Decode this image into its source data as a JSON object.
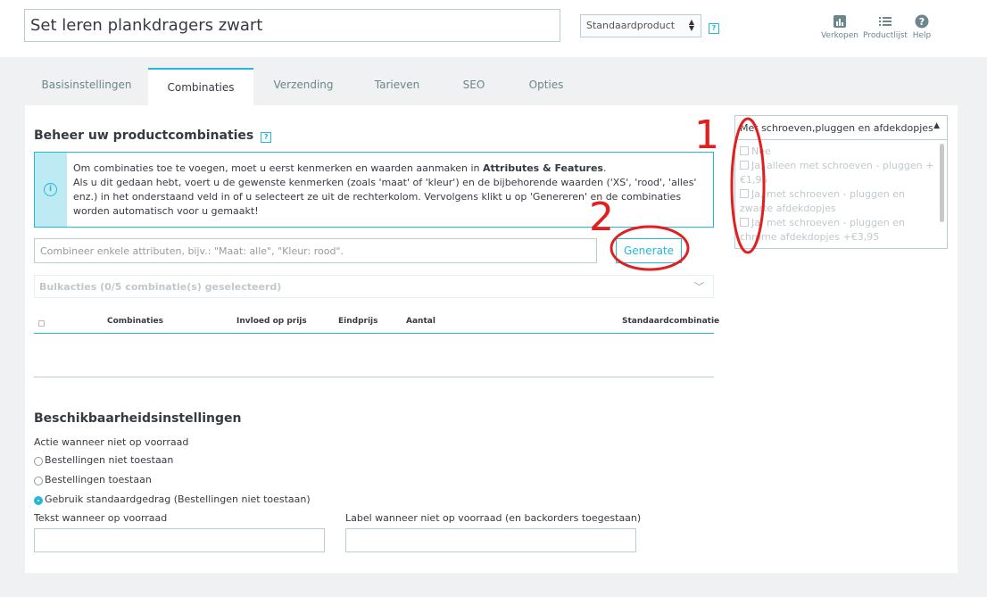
{
  "header": {
    "product_name": "Set leren plankdragers zwart",
    "product_type": "Standaardproduct",
    "help_mark": "?",
    "nav": [
      {
        "label": "Verkopen",
        "icon": "chart-bar-icon"
      },
      {
        "label": "Productlijst",
        "icon": "list-icon"
      },
      {
        "label": "Help",
        "icon": "help-circle-icon"
      }
    ]
  },
  "tabs": [
    "Basisinstellingen",
    "Combinaties",
    "Verzending",
    "Tarieven",
    "SEO",
    "Opties"
  ],
  "active_tab": "Combinaties",
  "combinations": {
    "title": "Beheer uw productcombinaties",
    "help_mark": "?",
    "info_text_1": "Om combinaties toe te voegen, moet u eerst kenmerken en waarden aanmaken in ",
    "info_link": "Attributes & Features",
    "info_text_2": ".",
    "info_text_3": "Als u dit gedaan hebt, voert u de gewenste kenmerken (zoals 'maat' of 'kleur') en de bijbehorende waarden ('XS', 'rood', 'alles' enz.) in het onderstaand veld in of u selecteert ze uit de rechterkolom. Vervolgens klikt u op 'Genereren' en de combinaties worden automatisch voor u gemaakt!",
    "input_placeholder": "Combineer enkele attributen, bijv.: \"Maat: alle\", \"Kleur: rood\".",
    "generate_label": "Generate",
    "bulk_label": "Bulkacties (0/5 combinatie(s) geselecteerd)",
    "columns": [
      "Combinaties",
      "Invloed op prijs",
      "Eindprijs",
      "Aantal",
      "Standaardcombinatie"
    ]
  },
  "availability": {
    "title": "Beschikbaarheidsinstellingen",
    "oos_action_label": "Actie wanneer niet op voorraad",
    "options": [
      {
        "label": "Bestellingen niet toestaan",
        "selected": false
      },
      {
        "label": "Bestellingen toestaan",
        "selected": false
      },
      {
        "label": "Gebruik standaardgedrag (Bestellingen niet toestaan)",
        "selected": true
      }
    ],
    "in_stock_label": "Tekst wanneer op voorraad",
    "backorder_label": "Label wanneer niet op voorraad (en backorders toegestaan)"
  },
  "attribute_dropdown": {
    "title": "Met schroeven,pluggen en afdekdopjes",
    "options": [
      "Nee",
      "Ja, alleen met schroeven - pluggen + €1,95",
      "Ja, met schroeven - pluggen en zwarte afdekdopjes",
      "Ja, met schroeven - pluggen en chrome afdekdopjes +€3,95"
    ]
  },
  "annotations": {
    "one": "1",
    "two": "2"
  },
  "colors": {
    "accent": "#25b9d7",
    "annotation": "#e02020",
    "text": "#363a41"
  }
}
